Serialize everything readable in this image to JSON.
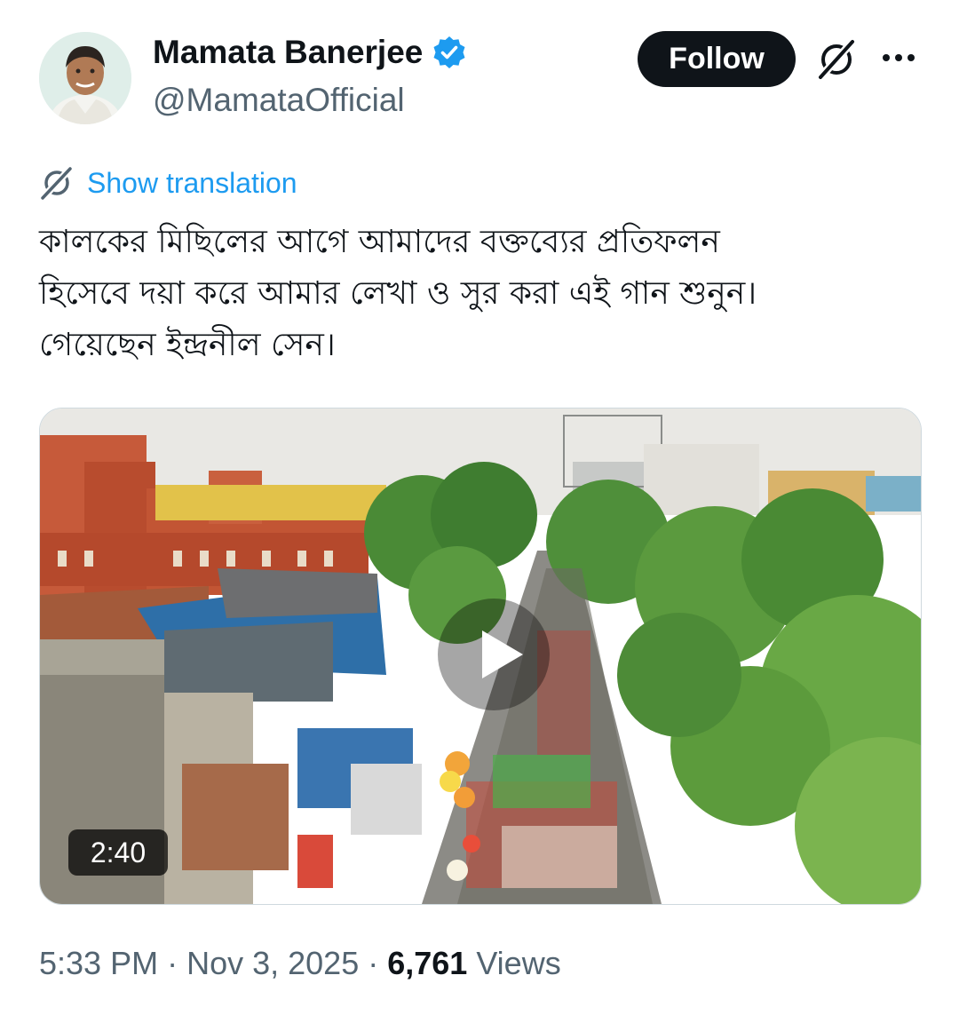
{
  "author": {
    "display_name": "Mamata Banerjee",
    "handle": "@MamataOfficial",
    "verified": true,
    "verified_color": "#1d9bf0"
  },
  "actions": {
    "follow_label": "Follow",
    "grok_icon": "grok-icon",
    "more_icon": "more-options-icon"
  },
  "translation": {
    "link_label": "Show translation",
    "link_color": "#1d9bf0"
  },
  "tweet": {
    "text": "কালকের মিছিলের আগে আমাদের বক্তব্যের প্রতিফলন\nহিসেবে দয়া করে আমার লেখা ও সুর করা এই গান শুনুন।\nগেয়েছেন ইন্দ্রনীল সেন।"
  },
  "media": {
    "type": "video",
    "duration": "2:40",
    "play_icon": "play-icon"
  },
  "meta": {
    "time": "5:33 PM",
    "separator": "·",
    "date": "Nov 3, 2025",
    "views_count": "6,761",
    "views_label": "Views"
  }
}
